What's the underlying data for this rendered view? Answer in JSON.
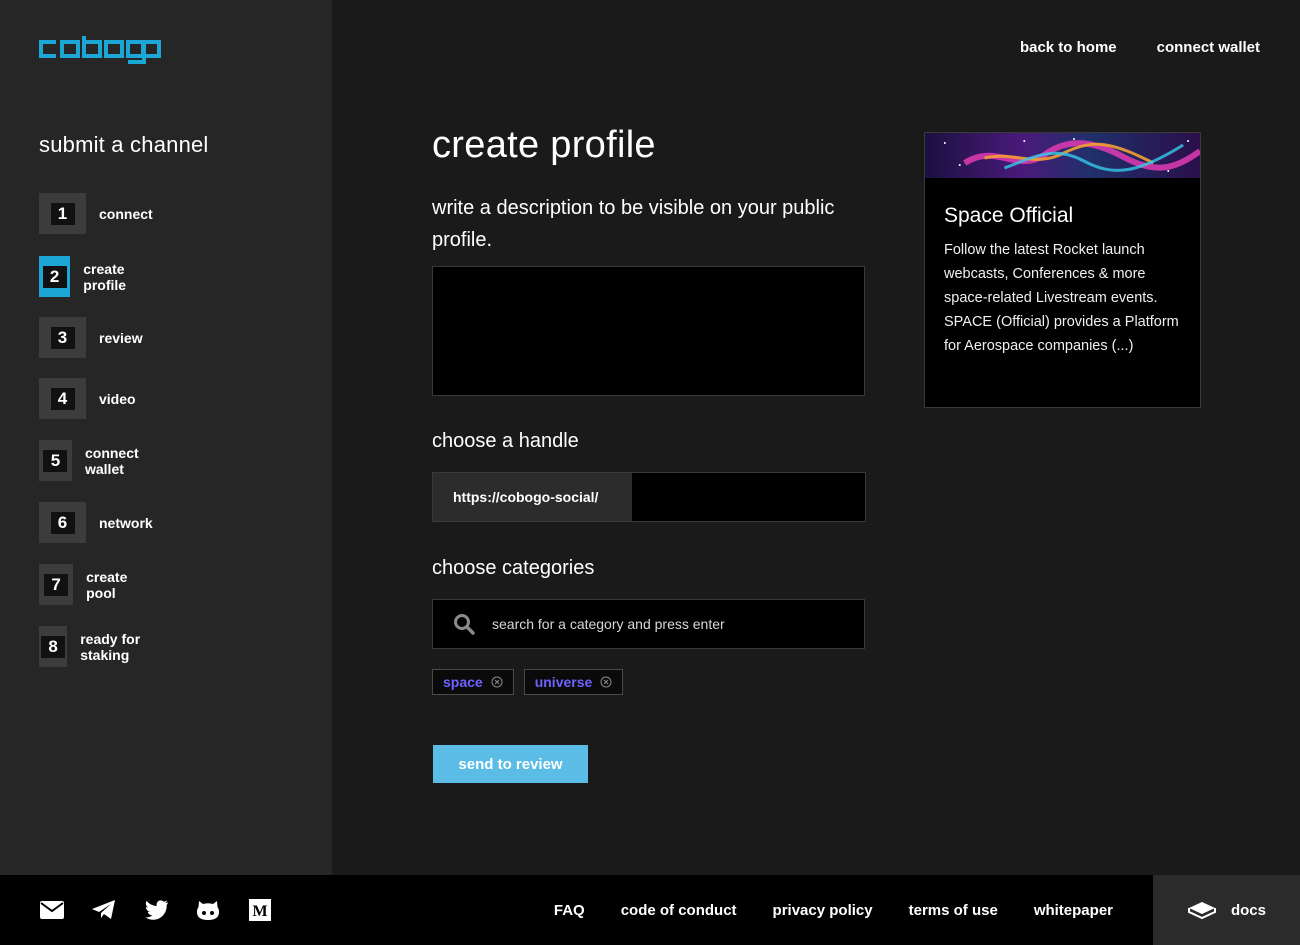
{
  "brand": {
    "logo_text": "cobogo",
    "accent_color": "#1ca6d6"
  },
  "sidebar": {
    "title": "submit a channel",
    "steps": [
      {
        "number": "1",
        "label": "connect",
        "active": false
      },
      {
        "number": "2",
        "label": "create profile",
        "active": true
      },
      {
        "number": "3",
        "label": "review",
        "active": false
      },
      {
        "number": "4",
        "label": "video",
        "active": false
      },
      {
        "number": "5",
        "label": "connect wallet",
        "active": false
      },
      {
        "number": "6",
        "label": "network",
        "active": false
      },
      {
        "number": "7",
        "label": "create pool",
        "active": false
      },
      {
        "number": "8",
        "label": "ready for staking",
        "active": false
      }
    ]
  },
  "topnav": {
    "back_home": "back to home",
    "connect_wallet": "connect wallet"
  },
  "main": {
    "title": "create profile",
    "description_label": "write a description to be visible on your public profile.",
    "description_value": "",
    "handle_label": "choose a handle",
    "handle_prefix": "https://cobogo-social/",
    "handle_value": "",
    "categories_label": "choose categories",
    "categories_placeholder": "search for a category and press enter",
    "tags": [
      {
        "label": "space",
        "icon": "close-circle-icon"
      },
      {
        "label": "universe",
        "icon": "close-circle-icon"
      }
    ],
    "tag_color": "#6c63ff",
    "submit_label": "send to review",
    "submit_color": "#5bbde6"
  },
  "preview_card": {
    "title": "Space Official",
    "description": "Follow the latest Rocket launch webcasts, Conferences & more space-related Livestream events. SPACE (Official) provides a Platform for Aerospace companies (...)"
  },
  "footer": {
    "social_icons": [
      "email-icon",
      "telegram-icon",
      "twitter-icon",
      "github-icon",
      "medium-icon"
    ],
    "links": [
      "FAQ",
      "code of conduct",
      "privacy policy",
      "terms of use",
      "whitepaper"
    ],
    "docs_label": "docs",
    "docs_icon": "book-icon"
  }
}
